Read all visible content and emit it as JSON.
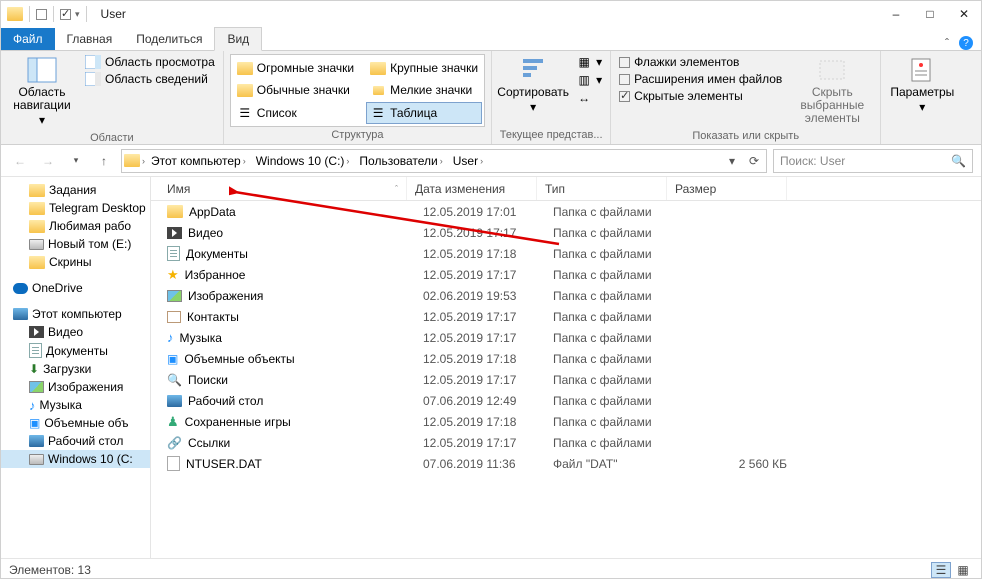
{
  "window": {
    "title": "User"
  },
  "tabs": {
    "file": "Файл",
    "home": "Главная",
    "share": "Поделиться",
    "view": "Вид"
  },
  "ribbon": {
    "panes_group": "Области",
    "nav_pane": "Область навигации",
    "preview_pane": "Область просмотра",
    "details_pane": "Область сведений",
    "layout_group": "Структура",
    "huge_icons": "Огромные значки",
    "large_icons": "Крупные значки",
    "medium_icons": "Обычные значки",
    "small_icons": "Мелкие значки",
    "list": "Список",
    "details": "Таблица",
    "current_view_group": "Текущее представ...",
    "sort": "Сортировать",
    "show_hide_group": "Показать или скрыть",
    "item_checkboxes": "Флажки элементов",
    "filename_ext": "Расширения имен файлов",
    "hidden_items": "Скрытые элементы",
    "hide_selected": "Скрыть выбранные элементы",
    "options": "Параметры"
  },
  "breadcrumbs": {
    "this_pc": "Этот компьютер",
    "c_drive": "Windows 10 (C:)",
    "users": "Пользователи",
    "user": "User"
  },
  "search": {
    "placeholder": "Поиск: User"
  },
  "tree": {
    "items_top": [
      {
        "label": "Задания",
        "icon": "folder"
      },
      {
        "label": "Telegram Desktор",
        "icon": "folder"
      },
      {
        "label": "Любимая рабо",
        "icon": "folder"
      },
      {
        "label": "Новый том (E:)",
        "icon": "drive"
      },
      {
        "label": "Скрины",
        "icon": "folder"
      }
    ],
    "onedrive": "OneDrive",
    "this_pc": "Этот компьютер",
    "pc_children": [
      {
        "label": "Видео",
        "icon": "vid"
      },
      {
        "label": "Документы",
        "icon": "doc"
      },
      {
        "label": "Загрузки",
        "icon": "down"
      },
      {
        "label": "Изображения",
        "icon": "pic"
      },
      {
        "label": "Музыка",
        "icon": "note"
      },
      {
        "label": "Объемные объ",
        "icon": "3d"
      },
      {
        "label": "Рабочий стол",
        "icon": "pc"
      },
      {
        "label": "Windows 10 (C:",
        "icon": "drive",
        "selected": true
      }
    ]
  },
  "columns": {
    "name": "Имя",
    "date": "Дата изменения",
    "type": "Тип",
    "size": "Размер"
  },
  "rows": [
    {
      "name": "AppData",
      "date": "12.05.2019 17:01",
      "type": "Папка с файлами",
      "size": "",
      "icon": "folder"
    },
    {
      "name": "Видео",
      "date": "12.05.2019 17:17",
      "type": "Папка с файлами",
      "size": "",
      "icon": "vid"
    },
    {
      "name": "Документы",
      "date": "12.05.2019 17:18",
      "type": "Папка с файлами",
      "size": "",
      "icon": "doc"
    },
    {
      "name": "Избранное",
      "date": "12.05.2019 17:17",
      "type": "Папка с файлами",
      "size": "",
      "icon": "star"
    },
    {
      "name": "Изображения",
      "date": "02.06.2019 19:53",
      "type": "Папка с файлами",
      "size": "",
      "icon": "pic"
    },
    {
      "name": "Контакты",
      "date": "12.05.2019 17:17",
      "type": "Папка с файлами",
      "size": "",
      "icon": "contact"
    },
    {
      "name": "Музыка",
      "date": "12.05.2019 17:17",
      "type": "Папка с файлами",
      "size": "",
      "icon": "note"
    },
    {
      "name": "Объемные объекты",
      "date": "12.05.2019 17:18",
      "type": "Папка с файлами",
      "size": "",
      "icon": "3d"
    },
    {
      "name": "Поиски",
      "date": "12.05.2019 17:17",
      "type": "Папка с файлами",
      "size": "",
      "icon": "search"
    },
    {
      "name": "Рабочий стол",
      "date": "07.06.2019 12:49",
      "type": "Папка с файлами",
      "size": "",
      "icon": "pc"
    },
    {
      "name": "Сохраненные игры",
      "date": "12.05.2019 17:18",
      "type": "Папка с файлами",
      "size": "",
      "icon": "game"
    },
    {
      "name": "Ссылки",
      "date": "12.05.2019 17:17",
      "type": "Папка с файлами",
      "size": "",
      "icon": "link"
    },
    {
      "name": "NTUSER.DAT",
      "date": "07.06.2019 11:36",
      "type": "Файл \"DAT\"",
      "size": "2 560 КБ",
      "icon": "file"
    }
  ],
  "status": {
    "count_label": "Элементов: 13"
  }
}
